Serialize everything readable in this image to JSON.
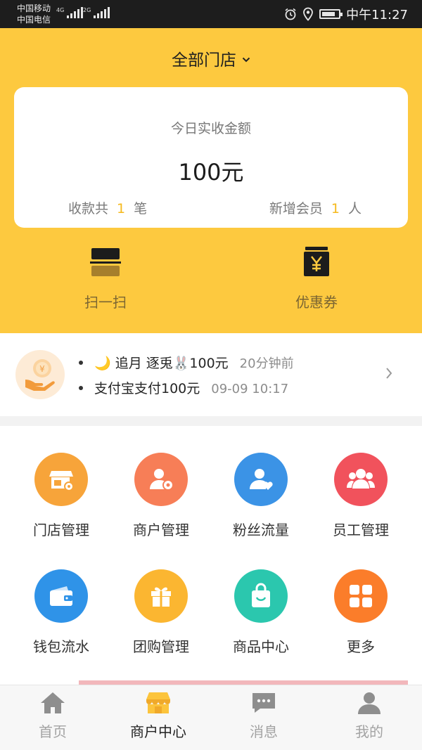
{
  "status_bar": {
    "carrier_1": "中国移动",
    "carrier_2": "中国电信",
    "network_1": "4G",
    "network_2": "2G",
    "time": "中午11:27",
    "icons": [
      "alarm-icon",
      "location-icon",
      "battery-charging-icon"
    ]
  },
  "header": {
    "store_selector": "全部门店",
    "summary": {
      "title": "今日实收金额",
      "amount": "100元",
      "payments_label": "收款共",
      "payments_count": "1",
      "payments_unit": "笔",
      "members_label": "新增会员",
      "members_count": "1",
      "members_unit": "人"
    },
    "quick_actions": [
      {
        "label": "扫一扫",
        "icon": "scan-icon"
      },
      {
        "label": "优惠券",
        "icon": "coupon-icon"
      }
    ]
  },
  "transactions": [
    {
      "text": "🌙 追月 逐兎🐰100元",
      "time": "20分钟前"
    },
    {
      "text": "支付宝支付100元",
      "time": "09-09 10:17"
    }
  ],
  "features": [
    {
      "label": "门店管理",
      "icon": "store-settings-icon",
      "color": "#f7a43a"
    },
    {
      "label": "商户管理",
      "icon": "merchant-settings-icon",
      "color": "#f77e57"
    },
    {
      "label": "粉丝流量",
      "icon": "fans-icon",
      "color": "#3b93e6"
    },
    {
      "label": "员工管理",
      "icon": "staff-group-icon",
      "color": "#f1525c"
    },
    {
      "label": "钱包流水",
      "icon": "wallet-icon",
      "color": "#2f93e8"
    },
    {
      "label": "团购管理",
      "icon": "gift-icon",
      "color": "#fbb631"
    },
    {
      "label": "商品中心",
      "icon": "shopping-bag-icon",
      "color": "#2bc7ae"
    },
    {
      "label": "更多",
      "icon": "grid-more-icon",
      "color": "#fb7d2a"
    }
  ],
  "tabbar": [
    {
      "label": "首页",
      "icon": "home-icon"
    },
    {
      "label": "商户中心",
      "icon": "shop-icon",
      "active": true
    },
    {
      "label": "消息",
      "icon": "message-icon"
    },
    {
      "label": "我的",
      "icon": "profile-icon"
    }
  ],
  "colors": {
    "brand_yellow": "#fdc93f",
    "accent_number": "#f5b91c"
  }
}
